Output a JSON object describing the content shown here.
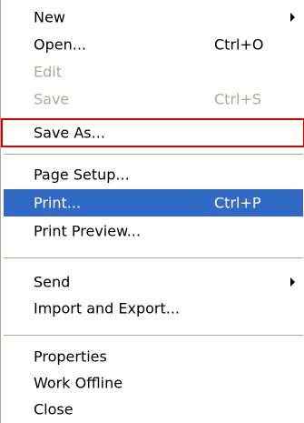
{
  "menu": {
    "new": {
      "label": "New",
      "shortcut": ""
    },
    "open": {
      "label": "Open...",
      "shortcut": "Ctrl+O"
    },
    "edit": {
      "label": "Edit",
      "shortcut": ""
    },
    "save": {
      "label": "Save",
      "shortcut": "Ctrl+S"
    },
    "save_as": {
      "label": "Save As...",
      "shortcut": ""
    },
    "page_setup": {
      "label": "Page Setup...",
      "shortcut": ""
    },
    "print": {
      "label": "Print...",
      "shortcut": "Ctrl+P"
    },
    "print_preview": {
      "label": "Print Preview...",
      "shortcut": ""
    },
    "send": {
      "label": "Send",
      "shortcut": ""
    },
    "import_export": {
      "label": "Import and Export...",
      "shortcut": ""
    },
    "properties": {
      "label": "Properties",
      "shortcut": ""
    },
    "work_offline": {
      "label": "Work Offline",
      "shortcut": ""
    },
    "close": {
      "label": "Close",
      "shortcut": ""
    }
  },
  "colors": {
    "highlight": "#316ac5",
    "disabled_text": "#aca899",
    "callout_border": "#dc0000"
  },
  "icons": {
    "submenu": "submenu-arrow-icon"
  }
}
